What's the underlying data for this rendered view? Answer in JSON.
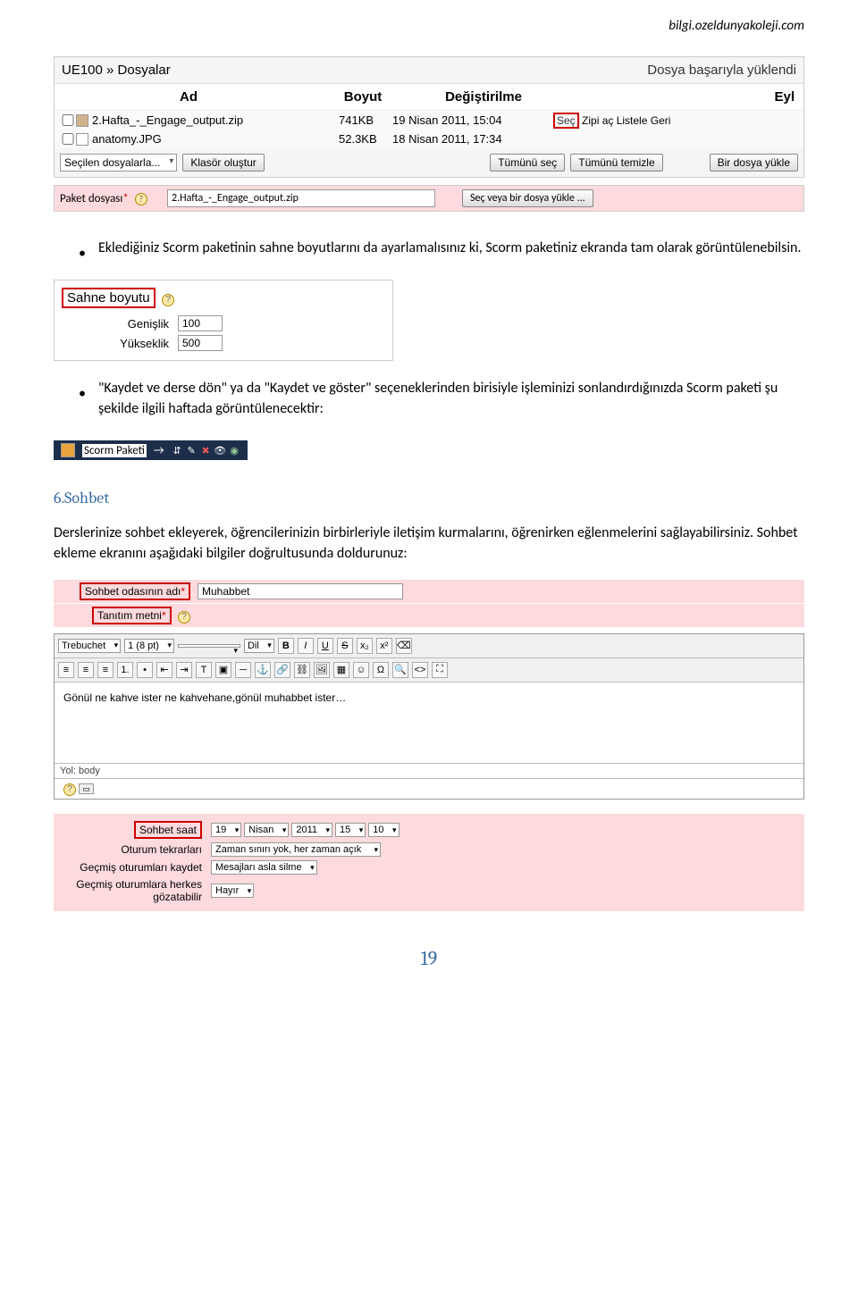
{
  "header": {
    "url": "bilgi.ozeldunyakoleji.com"
  },
  "fileManager": {
    "breadcrumb": "UE100 » Dosyalar",
    "successMsg": "Dosya başarıyla yüklendi",
    "columns": {
      "name": "Ad",
      "size": "Boyut",
      "modified": "Değiştirilme",
      "action": "Eyl"
    },
    "rows": [
      {
        "name": "2.Hafta_-_Engage_output.zip",
        "size": "741KB",
        "date": "19 Nisan 2011, 15:04",
        "actions": {
          "sec": "Seç",
          "rest": "Zipi aç Listele Geri"
        },
        "iconType": "zip"
      },
      {
        "name": "anatomy.JPG",
        "size": "52.3KB",
        "date": "18 Nisan 2011, 17:34",
        "actions": {
          "sec": "",
          "rest": ""
        },
        "iconType": "img"
      }
    ],
    "actionBar": {
      "selectLabel": "Seçilen dosyalarla...",
      "btnFolder": "Klasör oluştur",
      "btnSelectAll": "Tümünü seç",
      "btnClearAll": "Tümünü temizle",
      "btnUpload": "Bir dosya yükle"
    }
  },
  "paket": {
    "label": "Paket dosyası",
    "asterisk": "*",
    "help": "?",
    "value": "2.Hafta_-_Engage_output.zip",
    "button": "Seç veya bir dosya yükle ..."
  },
  "bullet1": "Eklediğiniz Scorm paketinin sahne boyutlarını da ayarlamalısınız ki, Scorm paketiniz ekranda tam olarak görüntülenebilsin.",
  "sahne": {
    "title": "Sahne boyutu",
    "help": "?",
    "widthLabel": "Genişlik",
    "widthValue": "100",
    "heightLabel": "Yükseklik",
    "heightValue": "500"
  },
  "bullet2": "\"Kaydet ve derse dön\" ya da \"Kaydet ve göster\" seçeneklerinden birisiyle işleminizi sonlandırdığınızda Scorm paketi şu şekilde ilgili haftada görüntülenecektir:",
  "scormIndicator": {
    "text": "Scorm Paketi",
    "arrow": "→"
  },
  "section6": {
    "heading": "6.Sohbet",
    "body": "Derslerinize sohbet ekleyerek, öğrencilerinizin birbirleriyle iletişim kurmalarını, öğrenirken eğlenmelerini sağlayabilirsiniz. Sohbet ekleme ekranını aşağıdaki bilgiler doğrultusunda doldurunuz:"
  },
  "sohbetForm": {
    "nameLabel": "Sohbet odasının adı",
    "asterisk": "*",
    "nameValue": "Muhabbet",
    "introLabel": "Tanıtım metni",
    "help": "?"
  },
  "editor": {
    "toolbar": {
      "font": "Trebuchet",
      "size": "1 (8 pt)",
      "lang": "Dil"
    },
    "content": "Gönül ne kahve ister ne kahvehane,gönül muhabbet ister…",
    "pathLabel": "Yol: body",
    "helpBtn": "?"
  },
  "bottomForm": {
    "timeRow": {
      "label": "Sohbet saat",
      "day": "19",
      "month": "Nisan",
      "year": "2011",
      "hour": "15",
      "min": "10"
    },
    "repeatRow": {
      "label": "Oturum tekrarları",
      "value": "Zaman sınırı yok, her zaman açık"
    },
    "saveRow": {
      "label": "Geçmiş oturumları kaydet",
      "value": "Mesajları asla silme"
    },
    "accessRow": {
      "label": "Geçmiş oturumlara herkes gözatabilir",
      "value": "Hayır"
    }
  },
  "pageNumber": "19"
}
